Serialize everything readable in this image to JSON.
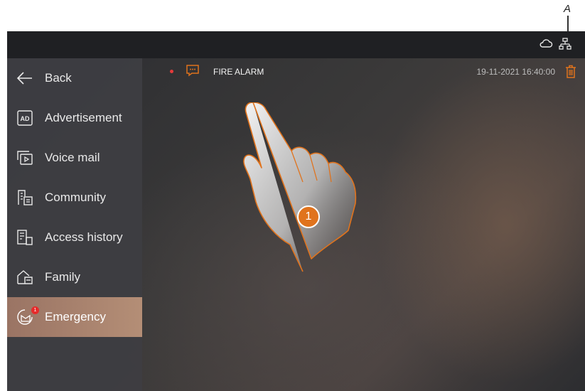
{
  "callout": {
    "letter": "A"
  },
  "statusbar": {
    "icons": [
      "cloud-icon",
      "network-icon"
    ]
  },
  "sidebar": {
    "items": [
      {
        "label": "Back",
        "icon": "back-arrow-icon",
        "active": false
      },
      {
        "label": "Advertisement",
        "icon": "ad-icon",
        "active": false
      },
      {
        "label": "Voice mail",
        "icon": "voicemail-icon",
        "active": false
      },
      {
        "label": "Community",
        "icon": "community-icon",
        "active": false
      },
      {
        "label": "Access history",
        "icon": "access-history-icon",
        "active": false
      },
      {
        "label": "Family",
        "icon": "family-icon",
        "active": false
      },
      {
        "label": "Emergency",
        "icon": "emergency-icon",
        "active": true,
        "badge": "1"
      }
    ]
  },
  "message": {
    "title": "FIRE ALARM",
    "timestamp": "19-11-2021 16:40:00",
    "unread": true
  },
  "step": {
    "number": "1"
  },
  "colors": {
    "accent": "#e0731d",
    "active_item": "#b48e76",
    "unread": "#e53b3b"
  }
}
